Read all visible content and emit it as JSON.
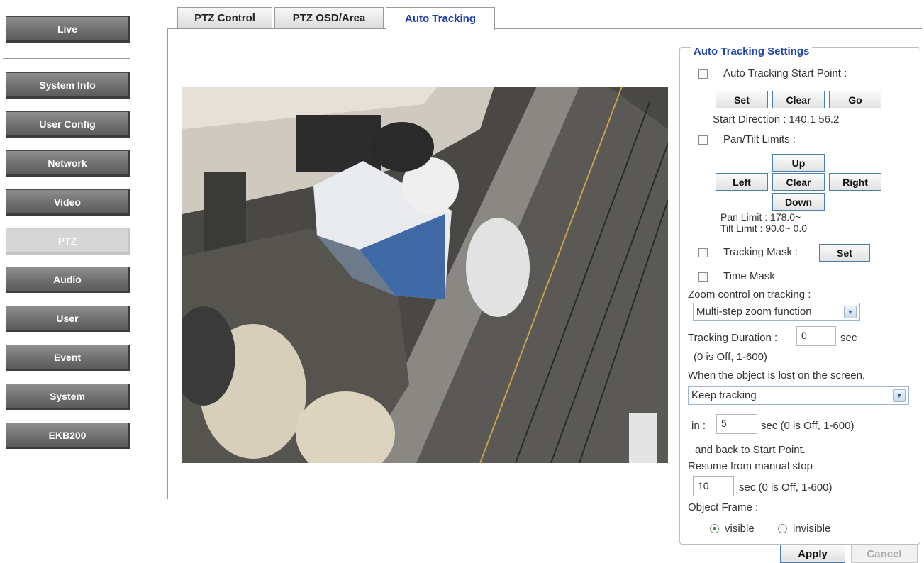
{
  "sidebar": {
    "live": "Live",
    "items": [
      {
        "label": "System Info"
      },
      {
        "label": "User Config"
      },
      {
        "label": "Network"
      },
      {
        "label": "Video"
      },
      {
        "label": "PTZ",
        "active": true
      },
      {
        "label": "Audio"
      },
      {
        "label": "User"
      },
      {
        "label": "Event"
      },
      {
        "label": "System"
      },
      {
        "label": "EKB200"
      }
    ]
  },
  "tabs": [
    {
      "label": "PTZ Control"
    },
    {
      "label": "PTZ OSD/Area"
    },
    {
      "label": "Auto Tracking",
      "active": true
    }
  ],
  "settings": {
    "legend": "Auto Tracking Settings",
    "start_point": {
      "label": "Auto Tracking Start Point :",
      "set": "Set",
      "clear": "Clear",
      "go": "Go",
      "direction": "Start Direction : 140.1 56.2"
    },
    "pan_tilt": {
      "label": "Pan/Tilt Limits :",
      "up": "Up",
      "left": "Left",
      "clear": "Clear",
      "right": "Right",
      "down": "Down",
      "pan_limit": "Pan Limit : 178.0~",
      "tilt_limit": "Tilt Limit : 90.0~ 0.0"
    },
    "tracking_mask": {
      "label": "Tracking Mask :",
      "set": "Set"
    },
    "time_mask": {
      "label": "Time Mask"
    },
    "zoom": {
      "label": "Zoom control on tracking :",
      "selected": "Multi-step zoom function"
    },
    "duration": {
      "label": "Tracking Duration :",
      "value": "0",
      "unit": "sec",
      "hint": "(0 is Off, 1-600)"
    },
    "lost": {
      "label": "When the object is lost on the screen,",
      "selected": "Keep tracking",
      "in_label": "in :",
      "in_value": "5",
      "in_hint": "sec (0 is Off, 1-600)",
      "back": "and back to Start Point."
    },
    "resume": {
      "label": "Resume from manual stop",
      "value": "10",
      "hint": "sec (0 is Off, 1-600)"
    },
    "object_frame": {
      "label": "Object Frame :",
      "visible": "visible",
      "invisible": "invisible",
      "selected": "visible"
    },
    "apply": "Apply",
    "cancel": "Cancel"
  },
  "colors": {
    "accent": "#2249b0",
    "active_tab_text": "#1f3fa8",
    "radio_on": "#2e9a2e"
  }
}
